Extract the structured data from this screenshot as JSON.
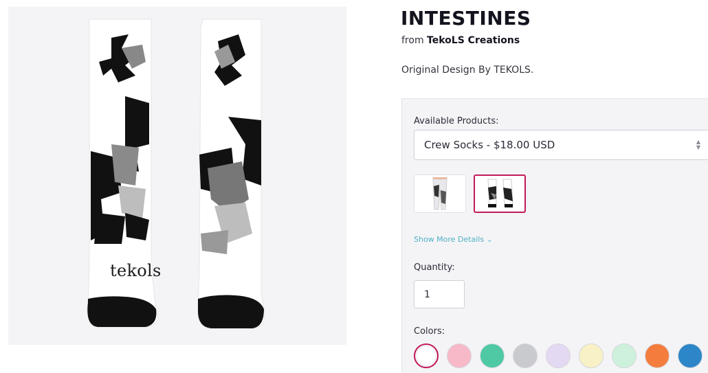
{
  "product": {
    "title": "INTESTINES",
    "from_prefix": "from",
    "store_name": "TekoLS Creations",
    "description": "Original Design By TEKOLS.",
    "image_brand_text": "tekols"
  },
  "options": {
    "available_products_label": "Available Products:",
    "selected_product": "Crew Socks - $18.00 USD",
    "show_more_details": "Show More Details",
    "quantity_label": "Quantity:",
    "quantity_value": "1",
    "colors_label": "Colors:",
    "thumbnails": [
      {
        "name": "leggings",
        "selected": false
      },
      {
        "name": "crew-socks",
        "selected": true
      }
    ],
    "colors": [
      {
        "name": "white",
        "hex": "#ffffff",
        "selected": true
      },
      {
        "name": "pink",
        "hex": "#f7b9c8",
        "selected": false
      },
      {
        "name": "mint",
        "hex": "#4fc9a4",
        "selected": false
      },
      {
        "name": "grey",
        "hex": "#c9cacd",
        "selected": false
      },
      {
        "name": "lavender",
        "hex": "#e4d9f2",
        "selected": false
      },
      {
        "name": "cream",
        "hex": "#f8f1c6",
        "selected": false
      },
      {
        "name": "light-green",
        "hex": "#cdf1dc",
        "selected": false
      },
      {
        "name": "orange",
        "hex": "#f47d3e",
        "selected": false
      },
      {
        "name": "blue",
        "hex": "#2c86c7",
        "selected": false
      }
    ]
  },
  "colors": {
    "accent": "#c2185b",
    "link": "#4fb0c6"
  }
}
